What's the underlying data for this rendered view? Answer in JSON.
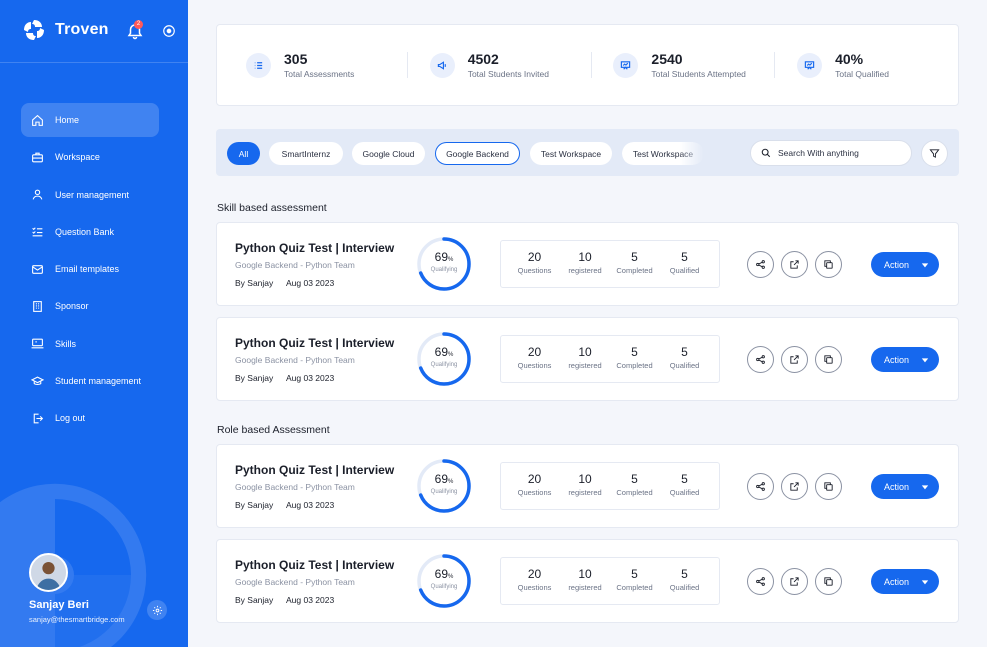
{
  "brand": {
    "name": "Troven",
    "notifications": "2"
  },
  "nav": [
    {
      "label": "Home",
      "icon": "home-icon",
      "active": true
    },
    {
      "label": "Workspace",
      "icon": "briefcase-icon"
    },
    {
      "label": "User management",
      "icon": "user-icon"
    },
    {
      "label": "Question Bank",
      "icon": "list-check-icon"
    },
    {
      "label": "Email templates",
      "icon": "mail-icon"
    },
    {
      "label": "Sponsor",
      "icon": "building-icon"
    },
    {
      "label": "Skills",
      "icon": "monitor-icon"
    },
    {
      "label": "Student management",
      "icon": "graduation-cap-icon"
    },
    {
      "label": "Log out",
      "icon": "logout-icon"
    }
  ],
  "user": {
    "name": "Sanjay Beri",
    "email": "sanjay@thesmartbridge.com"
  },
  "stats": [
    {
      "value": "305",
      "label": "Total Assessments",
      "icon": "list-icon"
    },
    {
      "value": "4502",
      "label": "Total Students Invited",
      "icon": "megaphone-icon"
    },
    {
      "value": "2540",
      "label": "Total Students Attempted",
      "icon": "presentation-icon"
    },
    {
      "value": "40%",
      "label": "Total Qualified",
      "icon": "presentation-icon"
    }
  ],
  "filters": [
    {
      "label": "All",
      "active": true
    },
    {
      "label": "SmartInternz"
    },
    {
      "label": "Google Cloud"
    },
    {
      "label": "Google Backend",
      "outlined": true
    },
    {
      "label": "Test Workspace"
    },
    {
      "label": "Test Workspace"
    }
  ],
  "search": {
    "placeholder": "Search With anything"
  },
  "sections": [
    {
      "title": "Skill based assessment"
    },
    {
      "title": "Role based Assessment"
    }
  ],
  "assessments": [
    {
      "title": "Python Quiz Test | Interview",
      "subtitle": "Google Backend - Python Team",
      "author": "By Sanjay",
      "date": "Aug 03 2023",
      "percent": "69",
      "percent_unit": "%",
      "percent_label": "Qualifying",
      "progress": 0.69,
      "metrics": [
        {
          "value": "20",
          "label": "Questions"
        },
        {
          "value": "10",
          "label": "registered"
        },
        {
          "value": "5",
          "label": "Completed"
        },
        {
          "value": "5",
          "label": "Qualified"
        }
      ],
      "action": "Action"
    },
    {
      "title": "Python Quiz Test | Interview",
      "subtitle": "Google Backend - Python Team",
      "author": "By Sanjay",
      "date": "Aug 03 2023",
      "percent": "69",
      "percent_unit": "%",
      "percent_label": "Qualifying",
      "progress": 0.69,
      "metrics": [
        {
          "value": "20",
          "label": "Questions"
        },
        {
          "value": "10",
          "label": "registered"
        },
        {
          "value": "5",
          "label": "Completed"
        },
        {
          "value": "5",
          "label": "Qualified"
        }
      ],
      "action": "Action"
    },
    {
      "title": "Python Quiz Test | Interview",
      "subtitle": "Google Backend - Python Team",
      "author": "By Sanjay",
      "date": "Aug 03 2023",
      "percent": "69",
      "percent_unit": "%",
      "percent_label": "Qualifying",
      "progress": 0.69,
      "metrics": [
        {
          "value": "20",
          "label": "Questions"
        },
        {
          "value": "10",
          "label": "registered"
        },
        {
          "value": "5",
          "label": "Completed"
        },
        {
          "value": "5",
          "label": "Qualified"
        }
      ],
      "action": "Action"
    },
    {
      "title": "Python Quiz Test | Interview",
      "subtitle": "Google Backend - Python Team",
      "author": "By Sanjay",
      "date": "Aug 03 2023",
      "percent": "69",
      "percent_unit": "%",
      "percent_label": "Qualifying",
      "progress": 0.69,
      "metrics": [
        {
          "value": "20",
          "label": "Questions"
        },
        {
          "value": "10",
          "label": "registered"
        },
        {
          "value": "5",
          "label": "Completed"
        },
        {
          "value": "5",
          "label": "Qualified"
        }
      ],
      "action": "Action"
    }
  ],
  "colors": {
    "primary": "#1668ee",
    "ring_track": "#e3eaf7",
    "background": "#f4f6fb"
  }
}
